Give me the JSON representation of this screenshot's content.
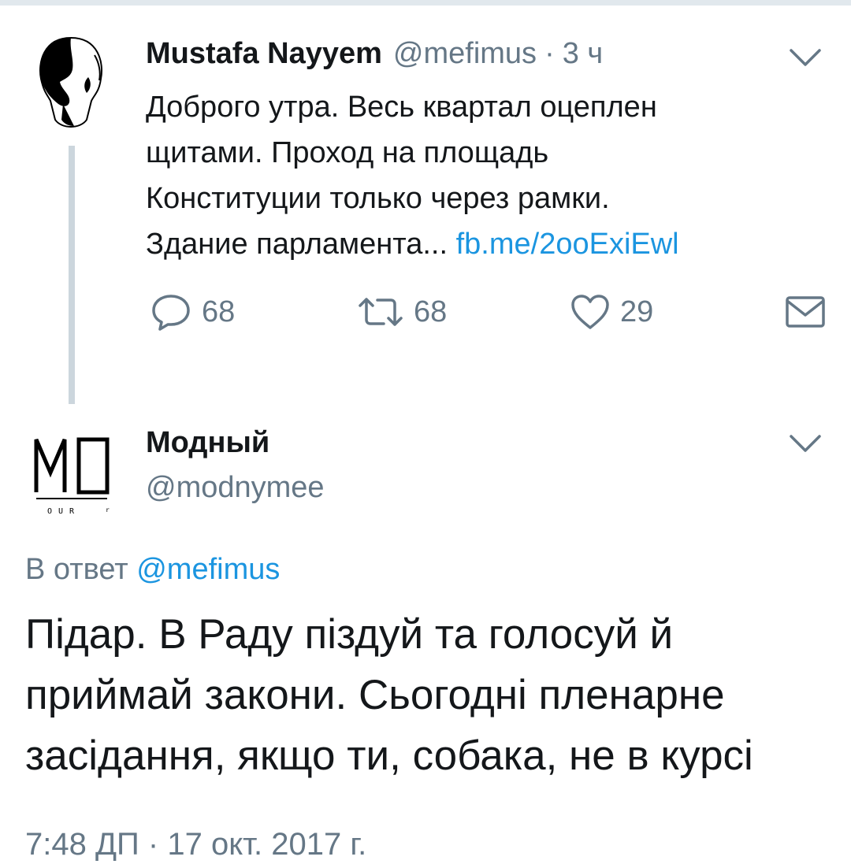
{
  "tweet1": {
    "author_name": "Mustafa Nayyem",
    "author_handle": "@mefimus",
    "separator": "·",
    "time_ago": "3 ч",
    "text_lines": [
      "Доброго утра. Весь квартал оцеплен",
      "щитами. Проход на площадь",
      "Конституции только через рамки.",
      "Здание парламента..."
    ],
    "link": "fb.me/2ooExiEwl",
    "actions": {
      "reply_count": "68",
      "retweet_count": "68",
      "like_count": "29"
    },
    "icons": {
      "reply": "reply-icon",
      "retweet": "retweet-icon",
      "like": "heart-icon",
      "dm": "envelope-icon",
      "menu": "chevron-down-icon"
    }
  },
  "tweet2": {
    "author_name": "Модный",
    "author_handle": "@modnymee",
    "reply_prefix": "В ответ",
    "reply_mention": "@mefimus",
    "text_lines": [
      "Підар. В Раду піздуй та голосуй й",
      "приймай закони. Сьогодні пленарне",
      "засідання, якщо ти, собака, не в курсі"
    ],
    "timestamp": "7:48 ДП · 17 окт. 2017 г.",
    "avatar_logo_text": "MO"
  },
  "colors": {
    "text_primary": "#14171a",
    "text_secondary": "#657786",
    "link": "#1b95e0",
    "thread_line": "#ccd6dd"
  }
}
